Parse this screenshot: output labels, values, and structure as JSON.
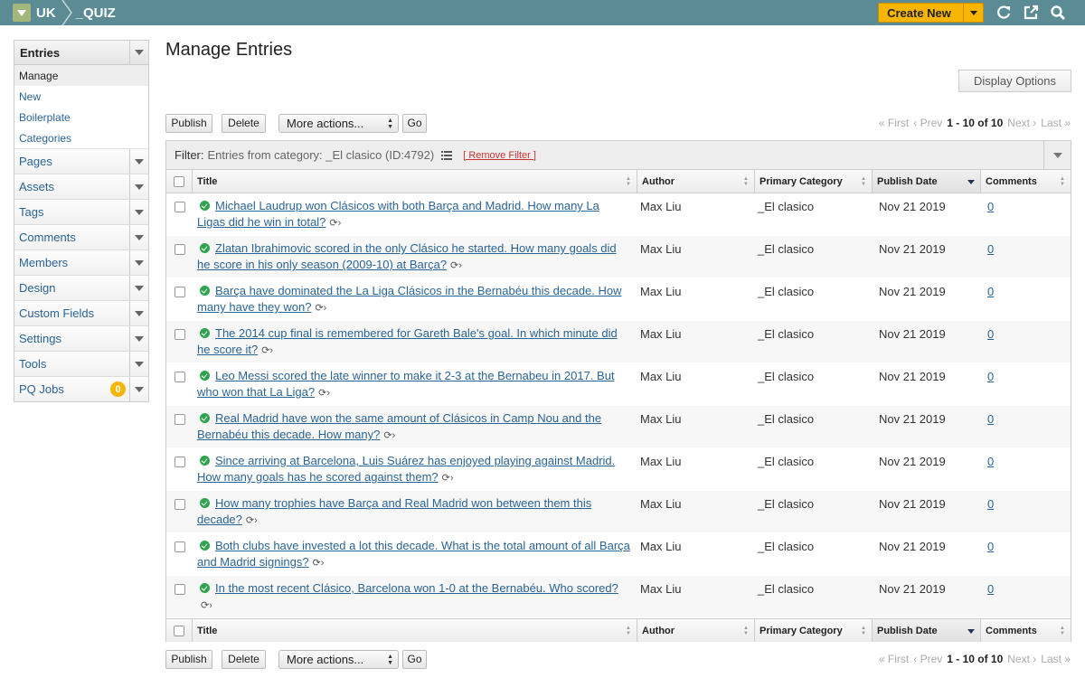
{
  "topbar": {
    "site": "UK",
    "channel": "_QUIZ",
    "create_label": "Create New",
    "icons": [
      "refresh-icon",
      "external-link-icon",
      "search-icon"
    ]
  },
  "sidebar": {
    "section": "Entries",
    "subitems": [
      {
        "label": "Manage",
        "active": true
      },
      {
        "label": "New"
      },
      {
        "label": "Boilerplate"
      },
      {
        "label": "Categories"
      }
    ],
    "items": [
      {
        "label": "Pages"
      },
      {
        "label": "Assets"
      },
      {
        "label": "Tags"
      },
      {
        "label": "Comments"
      },
      {
        "label": "Members"
      },
      {
        "label": "Design"
      },
      {
        "label": "Custom Fields"
      },
      {
        "label": "Settings"
      },
      {
        "label": "Tools"
      },
      {
        "label": "PQ Jobs",
        "badge": "0"
      }
    ]
  },
  "page": {
    "title": "Manage Entries",
    "display_options": "Display Options"
  },
  "actions": {
    "publish": "Publish",
    "delete": "Delete",
    "more": "More actions...",
    "go": "Go"
  },
  "pager": {
    "first": "« First",
    "prev": "‹ Prev",
    "range": "1 - 10 of 10",
    "next": "Next ›",
    "last": "Last »"
  },
  "filter": {
    "label": "Filter:",
    "value": "Entries from category: _El clasico (ID:4792)",
    "remove": "[ Remove Filter ]"
  },
  "columns": {
    "title": "Title",
    "author": "Author",
    "category": "Primary Category",
    "date": "Publish Date",
    "comments": "Comments"
  },
  "entries": [
    {
      "title": "Michael Laudrup won Clásicos with both Barça and Madrid. How many La Ligas did he win in total?",
      "author": "Max Liu",
      "category": "_El clasico",
      "date": "Nov 21 2019",
      "comments": "0"
    },
    {
      "title": "Zlatan Ibrahimovic scored in the only Clásico he started. How many goals did he score in his only season (2009-10) at Barça?",
      "author": "Max Liu",
      "category": "_El clasico",
      "date": "Nov 21 2019",
      "comments": "0"
    },
    {
      "title": "Barça have dominated the La Liga Clásicos in the Bernabéu this decade. How many have they won?",
      "author": "Max Liu",
      "category": "_El clasico",
      "date": "Nov 21 2019",
      "comments": "0"
    },
    {
      "title": "The 2014 cup final is remembered for Gareth Bale's goal. In which minute did he score it?",
      "author": "Max Liu",
      "category": "_El clasico",
      "date": "Nov 21 2019",
      "comments": "0"
    },
    {
      "title": "Leo Messi scored the late winner to make it 2-3 at the Bernabeu in 2017. But who won that La Liga?",
      "author": "Max Liu",
      "category": "_El clasico",
      "date": "Nov 21 2019",
      "comments": "0"
    },
    {
      "title": "Real Madrid have won the same amount of Clásicos in Camp Nou and the Bernabéu this decade. How many?",
      "author": "Max Liu",
      "category": "_El clasico",
      "date": "Nov 21 2019",
      "comments": "0"
    },
    {
      "title": "Since arriving at Barcelona, Luis Suárez has enjoyed playing against Madrid. How many goals has he scored against them?",
      "author": "Max Liu",
      "category": "_El clasico",
      "date": "Nov 21 2019",
      "comments": "0"
    },
    {
      "title": "How many trophies have Barça and Real Madrid won between them this decade?",
      "author": "Max Liu",
      "category": "_El clasico",
      "date": "Nov 21 2019",
      "comments": "0"
    },
    {
      "title": "Both clubs have invested a lot this decade. What is the total amount of all Barça and Madrid signings?",
      "author": "Max Liu",
      "category": "_El clasico",
      "date": "Nov 21 2019",
      "comments": "0"
    },
    {
      "title": "In the most recent Clásico, Barcelona won 1-0 at the Bernabéu. Who scored?",
      "author": "Max Liu",
      "category": "_El clasico",
      "date": "Nov 21 2019",
      "comments": "0"
    }
  ]
}
